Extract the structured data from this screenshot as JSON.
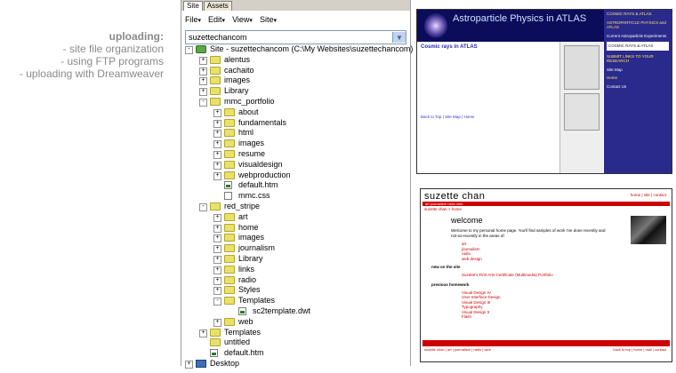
{
  "caption": {
    "heading": "uploading:",
    "lines": [
      "- site file organization",
      "- using FTP programs",
      "- uploading with Dreamweaver"
    ]
  },
  "panel": {
    "tabs": [
      "Site",
      "Assets"
    ],
    "menu": [
      "File",
      "Edit",
      "View",
      "Site"
    ],
    "site_select": "suzettechancom",
    "tree": [
      {
        "label": "Site - suzettechancom (C:\\My Websites\\suzettechancom)",
        "depth": 0,
        "type": "site",
        "exp": "-"
      },
      {
        "label": "alentus",
        "depth": 1,
        "type": "folder",
        "exp": "+"
      },
      {
        "label": "cachaito",
        "depth": 1,
        "type": "folder",
        "exp": "+"
      },
      {
        "label": "images",
        "depth": 1,
        "type": "folder",
        "exp": "+"
      },
      {
        "label": "Library",
        "depth": 1,
        "type": "folder",
        "exp": "+"
      },
      {
        "label": "mmc_portfolio",
        "depth": 1,
        "type": "folder",
        "exp": "-"
      },
      {
        "label": "about",
        "depth": 2,
        "type": "folder",
        "exp": "+"
      },
      {
        "label": "fundamentals",
        "depth": 2,
        "type": "folder",
        "exp": "+"
      },
      {
        "label": "html",
        "depth": 2,
        "type": "folder",
        "exp": "+"
      },
      {
        "label": "images",
        "depth": 2,
        "type": "folder",
        "exp": "+"
      },
      {
        "label": "resume",
        "depth": 2,
        "type": "folder",
        "exp": "+"
      },
      {
        "label": "visualdesign",
        "depth": 2,
        "type": "folder",
        "exp": "+"
      },
      {
        "label": "webproduction",
        "depth": 2,
        "type": "folder",
        "exp": "+"
      },
      {
        "label": "default.htm",
        "depth": 2,
        "type": "htm",
        "exp": ""
      },
      {
        "label": "mmc.css",
        "depth": 2,
        "type": "file",
        "exp": ""
      },
      {
        "label": "red_stripe",
        "depth": 1,
        "type": "folder",
        "exp": "-"
      },
      {
        "label": "art",
        "depth": 2,
        "type": "folder",
        "exp": "+"
      },
      {
        "label": "home",
        "depth": 2,
        "type": "folder",
        "exp": "+"
      },
      {
        "label": "images",
        "depth": 2,
        "type": "folder",
        "exp": "+"
      },
      {
        "label": "journalism",
        "depth": 2,
        "type": "folder",
        "exp": "+"
      },
      {
        "label": "Library",
        "depth": 2,
        "type": "folder",
        "exp": "+"
      },
      {
        "label": "links",
        "depth": 2,
        "type": "folder",
        "exp": "+"
      },
      {
        "label": "radio",
        "depth": 2,
        "type": "folder",
        "exp": "+"
      },
      {
        "label": "Styles",
        "depth": 2,
        "type": "folder",
        "exp": "+"
      },
      {
        "label": "Templates",
        "depth": 2,
        "type": "folder",
        "exp": "-"
      },
      {
        "label": "sc2template.dwt",
        "depth": 3,
        "type": "htm",
        "exp": ""
      },
      {
        "label": "web",
        "depth": 2,
        "type": "folder",
        "exp": "+"
      },
      {
        "label": "Templates",
        "depth": 1,
        "type": "folder",
        "exp": "+"
      },
      {
        "label": "untitled",
        "depth": 1,
        "type": "folder",
        "exp": ""
      },
      {
        "label": "default.htm",
        "depth": 1,
        "type": "htm",
        "exp": ""
      },
      {
        "label": "Desktop",
        "depth": 0,
        "type": "desktop",
        "exp": "+"
      }
    ]
  },
  "shot1": {
    "title": "Astroparticle Physics in ATLAS",
    "heading": "Cosmic rays in ATLAS",
    "side": [
      "COSMIC RAYS & ATLAS",
      "ASTROPARTICLE PHYSICS and ATLAS",
      "Current Astroparticle Experiments",
      "COSMIC RAYS & ATLAS",
      "SUBMIT LINKS TO YOUR RESEARCH",
      "Site Map",
      "Home",
      "Contact Us"
    ],
    "footer_link": "Back to Top | Site Map | Home"
  },
  "shot2": {
    "name": "suzette chan",
    "toplinks": "home | site | contact",
    "bar": "art journalism radio web",
    "crumb": "suzette chan > home",
    "welcome": "welcome",
    "intro": "Welcome to my personal home page. You'll find samples of work I've done recently and not-so-recently in the areas of:",
    "areas": [
      "art",
      "journalism",
      "radio",
      "web design"
    ],
    "new_heading": "new on the site",
    "new_item": "Suzette's First Arts Certificate (Multimedia) Portfolio",
    "prev_heading": "previous homework",
    "prev_items": [
      "Visual Design IV",
      "User Interface Design",
      "Visual Design III",
      "Typography",
      "Visual Design II",
      "Flash"
    ],
    "foot_left": "suzette chan | art | journalism | radio | web",
    "foot_right": "back to top | home | mail | contact"
  }
}
